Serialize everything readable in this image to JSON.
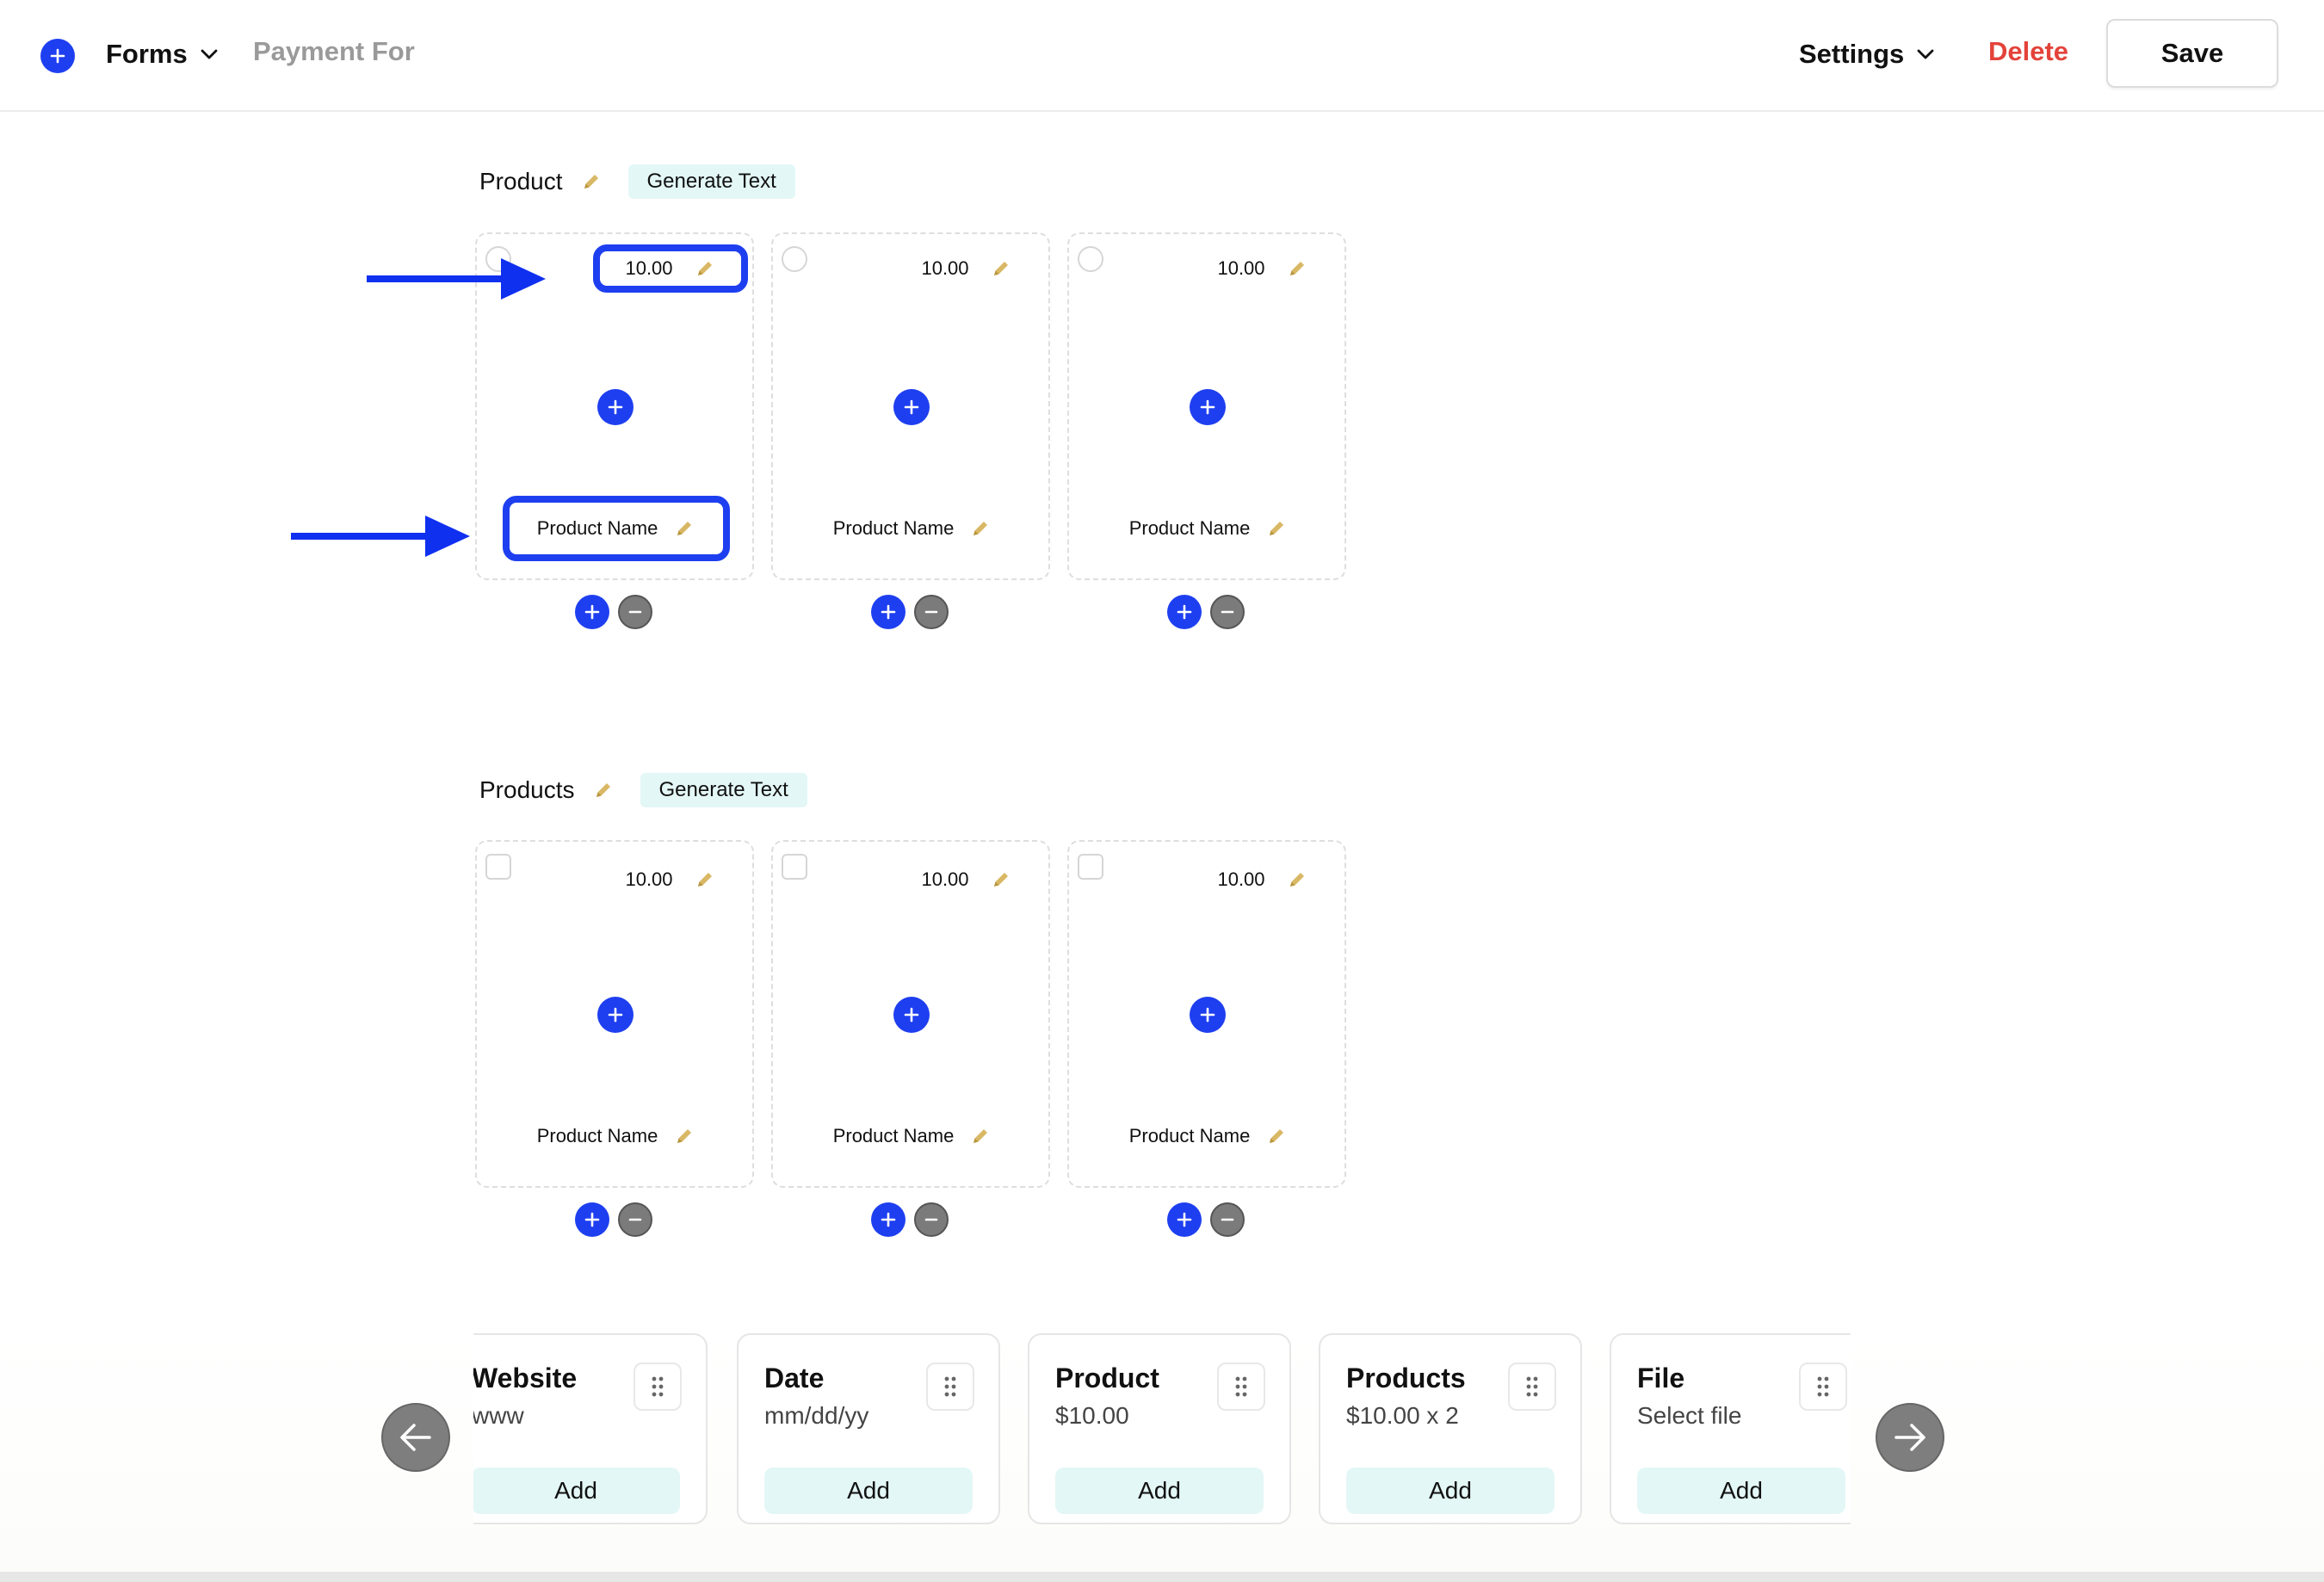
{
  "header": {
    "menu_label": "Forms",
    "breadcrumb": "Payment For",
    "settings_label": "Settings",
    "delete_label": "Delete",
    "save_label": "Save"
  },
  "colors": {
    "accent": "#1e3ff0",
    "danger": "#e3423a",
    "pencil": "#d9b865",
    "soft_teal": "#e3f7f6"
  },
  "icons": {
    "logo": "plus-circle-icon",
    "dropdown": "chevron-down-icon",
    "edit": "pencil-icon",
    "add": "plus-icon",
    "remove": "minus-icon",
    "drag": "drag-dots-icon",
    "prev": "arrow-left-icon",
    "next": "arrow-right-icon"
  },
  "sections": [
    {
      "title": "Product",
      "generate_label": "Generate Text",
      "selector": "radio",
      "cards": [
        {
          "price": "10.00",
          "name": "Product Name"
        },
        {
          "price": "10.00",
          "name": "Product Name"
        },
        {
          "price": "10.00",
          "name": "Product Name"
        }
      ]
    },
    {
      "title": "Products",
      "generate_label": "Generate Text",
      "selector": "checkbox",
      "cards": [
        {
          "price": "10.00",
          "name": "Product Name"
        },
        {
          "price": "10.00",
          "name": "Product Name"
        },
        {
          "price": "10.00",
          "name": "Product Name"
        }
      ]
    }
  ],
  "palette": {
    "add_label": "Add",
    "fields": [
      {
        "title": "Website",
        "subtitle": "www"
      },
      {
        "title": "Date",
        "subtitle": "mm/dd/yy"
      },
      {
        "title": "Product",
        "subtitle": "$10.00"
      },
      {
        "title": "Products",
        "subtitle": "$10.00 x 2"
      },
      {
        "title": "File",
        "subtitle": "Select file"
      }
    ]
  }
}
